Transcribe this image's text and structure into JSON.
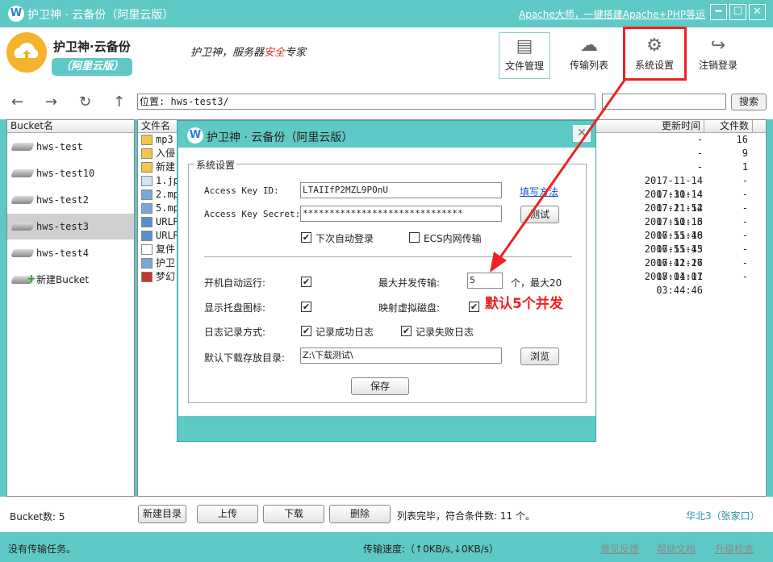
{
  "app": {
    "title": "护卫神 · 云备份（阿里云版）",
    "promo_link": "Apache大师，一键搭建Apache+PHP等运",
    "min_label": "━",
    "max_label": "☐",
    "close_label": "✕"
  },
  "brand": {
    "name": "护卫神·云备份",
    "sub": "（阿里云版）",
    "slogan_pre": "护卫神，服务器",
    "slogan_red": "安全",
    "slogan_post": "专家"
  },
  "toolbar": {
    "files": "文件管理",
    "transfers": "传输列表",
    "settings": "系统设置",
    "logout": "注销登录"
  },
  "nav": {
    "location_label": "位置:",
    "location_value": "hws-test3/",
    "search_button": "搜索"
  },
  "buckets": {
    "header": "Bucket名",
    "items": [
      "hws-test",
      "hws-test10",
      "hws-test2",
      "hws-test3",
      "hws-test4"
    ],
    "new_label": "新建Bucket"
  },
  "files": {
    "headers": {
      "name": "文件名",
      "time": "更新时间",
      "count": "文件数"
    },
    "rows": [
      {
        "name": "mp3",
        "date": "-",
        "count": "16"
      },
      {
        "name": "入侵",
        "date": "-",
        "count": "9"
      },
      {
        "name": "新建",
        "date": "-",
        "count": "1"
      },
      {
        "name": "1.jp",
        "date": "2017-11-14 07:30:14",
        "count": "-"
      },
      {
        "name": "2.mp",
        "date": "2017-11-14 07:21:52",
        "count": "-"
      },
      {
        "name": "5.mp",
        "date": "2017-11-14 07:50:13",
        "count": "-"
      },
      {
        "name": "URLR",
        "date": "2017-11-16 06:55:48",
        "count": "-"
      },
      {
        "name": "URLR",
        "date": "2017-11-16 06:55:43",
        "count": "-"
      },
      {
        "name": "复件",
        "date": "2017-11-15 06:42:27",
        "count": "-"
      },
      {
        "name": "护卫",
        "date": "2017-11-16 08:04:01",
        "count": "-"
      },
      {
        "name": "梦幻",
        "date": "2017-11-17 03:44:46",
        "count": "-"
      }
    ]
  },
  "bottom": {
    "bucket_count": "Bucket数: 5",
    "new_dir": "新建目录",
    "upload": "上传",
    "download": "下载",
    "delete": "删除",
    "list_status": "列表完毕，符合条件数: 11 个。",
    "region": "华北3（张家口）"
  },
  "status": {
    "text": "没有传输任务。",
    "speed": "传输速度:（↑0KB/s,↓0KB/s）",
    "feedback": "意见反馈",
    "help": "帮助文档",
    "upgrade": "升级检查"
  },
  "dialog": {
    "title": "护卫神 · 云备份（阿里云版）",
    "close": "✕",
    "group": "系统设置",
    "key_id_label": "Access Key ID:",
    "key_id_value": "LTAIIfP2MZL9POnU",
    "howto_link": "填写方法",
    "key_secret_label": "Access Key Secret:",
    "key_secret_value": "******************************",
    "test_button": "测试",
    "auto_login": "下次自动登录",
    "ecs_transfer": "ECS内网传输",
    "autostart_label": "开机自动运行:",
    "max_concurrent_label": "最大并发传输:",
    "max_concurrent_value": "5",
    "max_concurrent_suffix": "个，最大20",
    "tray_label": "显示托盘图标:",
    "vdisk_label": "映射虚拟磁盘:",
    "log_label": "日志记录方式:",
    "log_success": "记录成功日志",
    "log_fail": "记录失败日志",
    "download_dir_label": "默认下载存放目录:",
    "download_dir_value": "Z:\\下载测试\\",
    "browse_button": "浏览",
    "save_button": "保存",
    "check_mark": "✔"
  },
  "annotation": "默认5个并发"
}
